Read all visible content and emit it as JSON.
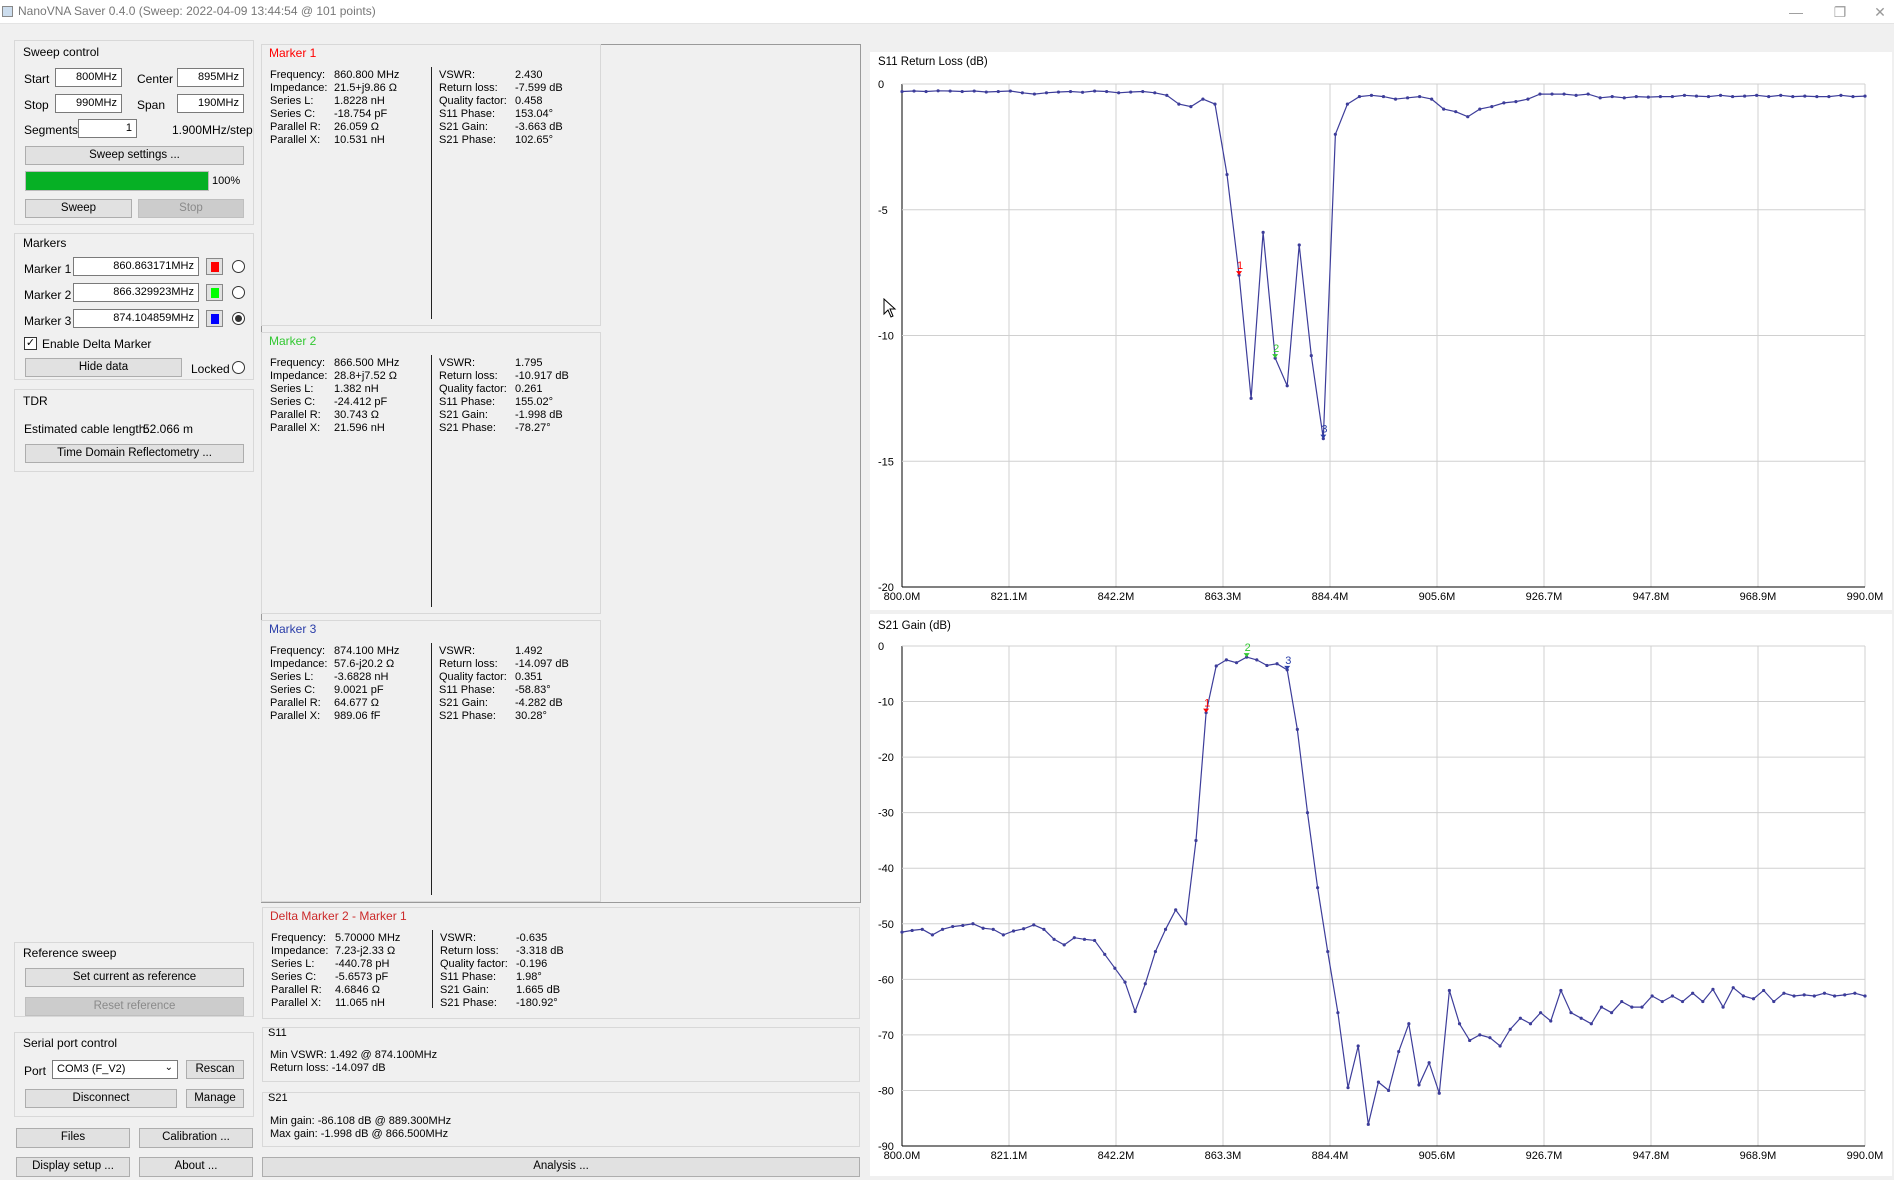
{
  "window": {
    "title": "NanoVNA Saver 0.4.0 (Sweep: 2022-04-09 13:44:54 @ 101 points)",
    "minimize": "—",
    "restore": "❐",
    "close": "✕"
  },
  "sweep_control": {
    "title": "Sweep control",
    "start_label": "Start",
    "start_value": "800MHz",
    "center_label": "Center",
    "center_value": "895MHz",
    "stop_label": "Stop",
    "stop_value": "990MHz",
    "span_label": "Span",
    "span_value": "190MHz",
    "segments_label": "Segments",
    "segments_value": "1",
    "step": "1.900MHz/step",
    "settings_button": "Sweep settings ...",
    "progress_percent": 100,
    "progress_label": "100%",
    "sweep_button": "Sweep",
    "stop_button": "Stop"
  },
  "markers": {
    "title": "Markers",
    "items": [
      {
        "label": "Marker 1",
        "value": "860.863171MHz",
        "color": "#ff0000",
        "selected": false
      },
      {
        "label": "Marker 2",
        "value": "866.329923MHz",
        "color": "#00ff00",
        "selected": false
      },
      {
        "label": "Marker 3",
        "value": "874.104859MHz",
        "color": "#0000ff",
        "selected": true
      }
    ],
    "delta_label": "Enable Delta Marker",
    "delta_checked": "✓",
    "hide_button": "Hide data",
    "locked_label": "Locked"
  },
  "tdr": {
    "title": "TDR",
    "cable_label": "Estimated cable length:",
    "cable_value": "52.066 m",
    "button": "Time Domain Reflectometry ..."
  },
  "reference": {
    "title": "Reference sweep",
    "set_button": "Set current as reference",
    "reset_button": "Reset reference"
  },
  "serial": {
    "title": "Serial port control",
    "port_label": "Port",
    "port_value": "COM3 (F_V2)",
    "rescan_button": "Rescan",
    "disconnect_button": "Disconnect",
    "manage_button": "Manage"
  },
  "bottom_buttons": {
    "files": "Files",
    "calibration": "Calibration ...",
    "display": "Display setup ...",
    "about": "About ...",
    "analysis": "Analysis ..."
  },
  "marker_panels": [
    {
      "title": "Marker 1",
      "color": "#ff0000",
      "left": [
        [
          "Frequency:",
          "860.800 MHz"
        ],
        [
          "Impedance:",
          "21.5+j9.86 Ω"
        ],
        [
          "Series L:",
          "1.8228 nH"
        ],
        [
          "Series C:",
          "-18.754 pF"
        ],
        [
          "Parallel R:",
          "26.059 Ω"
        ],
        [
          "Parallel X:",
          "10.531 nH"
        ]
      ],
      "right": [
        [
          "VSWR:",
          "2.430"
        ],
        [
          "Return loss:",
          "-7.599 dB"
        ],
        [
          "Quality factor:",
          "0.458"
        ],
        [
          "S11 Phase:",
          "153.04°"
        ],
        [
          "S21 Gain:",
          "-3.663 dB"
        ],
        [
          "S21 Phase:",
          "102.65°"
        ]
      ]
    },
    {
      "title": "Marker 2",
      "color": "#32c832",
      "left": [
        [
          "Frequency:",
          "866.500 MHz"
        ],
        [
          "Impedance:",
          "28.8+j7.52 Ω"
        ],
        [
          "Series L:",
          "1.382 nH"
        ],
        [
          "Series C:",
          "-24.412 pF"
        ],
        [
          "Parallel R:",
          "30.743 Ω"
        ],
        [
          "Parallel X:",
          "21.596 nH"
        ]
      ],
      "right": [
        [
          "VSWR:",
          "1.795"
        ],
        [
          "Return loss:",
          "-10.917 dB"
        ],
        [
          "Quality factor:",
          "0.261"
        ],
        [
          "S11 Phase:",
          "155.02°"
        ],
        [
          "S21 Gain:",
          "-1.998 dB"
        ],
        [
          "S21 Phase:",
          "-78.27°"
        ]
      ]
    },
    {
      "title": "Marker 3",
      "color": "#2a3da8",
      "left": [
        [
          "Frequency:",
          "874.100 MHz"
        ],
        [
          "Impedance:",
          "57.6-j20.2 Ω"
        ],
        [
          "Series L:",
          "-3.6828 nH"
        ],
        [
          "Series C:",
          "9.0021 pF"
        ],
        [
          "Parallel R:",
          "64.677 Ω"
        ],
        [
          "Parallel X:",
          "989.06 fF"
        ]
      ],
      "right": [
        [
          "VSWR:",
          "1.492"
        ],
        [
          "Return loss:",
          "-14.097 dB"
        ],
        [
          "Quality factor:",
          "0.351"
        ],
        [
          "S11 Phase:",
          "-58.83°"
        ],
        [
          "S21 Gain:",
          "-4.282 dB"
        ],
        [
          "S21 Phase:",
          "30.28°"
        ]
      ]
    },
    {
      "title": "Delta Marker 2 - Marker 1",
      "color": "#cc2a2a",
      "left": [
        [
          "Frequency:",
          "5.70000 MHz"
        ],
        [
          "Impedance:",
          "7.23-j2.33 Ω"
        ],
        [
          "Series L:",
          "-440.78 pH"
        ],
        [
          "Series C:",
          "-5.6573 pF"
        ],
        [
          "Parallel R:",
          "4.6846 Ω"
        ],
        [
          "Parallel X:",
          "11.065 nH"
        ]
      ],
      "right": [
        [
          "VSWR:",
          "-0.635"
        ],
        [
          "Return loss:",
          "-3.318 dB"
        ],
        [
          "Quality factor:",
          "-0.196"
        ],
        [
          "S11 Phase:",
          "1.98°"
        ],
        [
          "S21 Gain:",
          "1.665 dB"
        ],
        [
          "S21 Phase:",
          "-180.92°"
        ]
      ]
    }
  ],
  "s11_summary": {
    "title": "S11",
    "min_vswr": "Min VSWR:   1.492 @ 874.100MHz",
    "return_loss": "Return loss:  -14.097 dB"
  },
  "s21_summary": {
    "title": "S21",
    "min_gain": "Min gain:  -86.108 dB @ 889.300MHz",
    "max_gain": "Max gain:  -1.998 dB @ 866.500MHz"
  },
  "chart_data": [
    {
      "type": "line",
      "title": "S11 Return Loss (dB)",
      "xlim": [
        800,
        990
      ],
      "ylim": [
        -20,
        0
      ],
      "xticks": [
        "800.0M",
        "821.1M",
        "842.2M",
        "863.3M",
        "884.4M",
        "905.6M",
        "926.7M",
        "947.8M",
        "968.9M",
        "990.0M"
      ],
      "yticks": [
        0,
        -5,
        -10,
        -15,
        -20
      ],
      "grid": true,
      "color": "#3d3d9a",
      "values": [
        -0.3,
        -0.28,
        -0.3,
        -0.27,
        -0.28,
        -0.3,
        -0.28,
        -0.32,
        -0.3,
        -0.28,
        -0.35,
        -0.4,
        -0.35,
        -0.32,
        -0.3,
        -0.33,
        -0.28,
        -0.3,
        -0.35,
        -0.32,
        -0.3,
        -0.35,
        -0.45,
        -0.8,
        -0.9,
        -0.6,
        -0.8,
        -3.6,
        -7.6,
        -12.5,
        -5.9,
        -10.9,
        -12.0,
        -6.4,
        -10.8,
        -14.1,
        -2.0,
        -0.8,
        -0.5,
        -0.45,
        -0.5,
        -0.6,
        -0.55,
        -0.5,
        -0.6,
        -1.0,
        -1.1,
        -1.3,
        -1.0,
        -0.9,
        -0.75,
        -0.7,
        -0.6,
        -0.4,
        -0.4,
        -0.4,
        -0.45,
        -0.4,
        -0.55,
        -0.5,
        -0.55,
        -0.5,
        -0.52,
        -0.5,
        -0.5,
        -0.45,
        -0.48,
        -0.5,
        -0.45,
        -0.5,
        -0.48,
        -0.45,
        -0.5,
        -0.45,
        -0.5,
        -0.48,
        -0.5,
        -0.5,
        -0.45,
        -0.5,
        -0.48
      ],
      "markers": [
        {
          "label": "1",
          "index": 28,
          "color": "#ff0000"
        },
        {
          "label": "2",
          "index": 31,
          "color": "#32c832"
        },
        {
          "label": "3",
          "index": 35,
          "color": "#2a3da8"
        }
      ]
    },
    {
      "type": "line",
      "title": "S21 Gain (dB)",
      "xlim": [
        800,
        990
      ],
      "ylim": [
        -90,
        0
      ],
      "xticks": [
        "800.0M",
        "821.1M",
        "842.2M",
        "863.3M",
        "884.4M",
        "905.6M",
        "926.7M",
        "947.8M",
        "968.9M",
        "990.0M"
      ],
      "yticks": [
        0,
        -10,
        -20,
        -30,
        -40,
        -50,
        -60,
        -70,
        -80,
        -90
      ],
      "grid": true,
      "color": "#3d3d9a",
      "values": [
        -51.5,
        -51.2,
        -51,
        -52,
        -51,
        -50.5,
        -50.3,
        -50,
        -50.8,
        -51,
        -52,
        -51.3,
        -50.9,
        -50.2,
        -51,
        -52.8,
        -53.8,
        -52.5,
        -52.8,
        -53,
        -55.5,
        -58,
        -60.5,
        -65.8,
        -60.8,
        -55,
        -51,
        -47.5,
        -50,
        -35,
        -12,
        -3.6,
        -2.5,
        -3,
        -2,
        -2.5,
        -3.5,
        -3.2,
        -4.3,
        -15,
        -30,
        -43.5,
        -55,
        -66,
        -79.5,
        -72,
        -86.1,
        -78.5,
        -80,
        -73,
        -68,
        -79,
        -75,
        -80.5,
        -62,
        -68,
        -71,
        -70,
        -70.5,
        -72,
        -69,
        -67,
        -68,
        -66,
        -67.5,
        -62,
        -66,
        -67,
        -68,
        -65,
        -66,
        -64,
        -65,
        -65,
        -63,
        -64,
        -63,
        -64,
        -62.5,
        -64,
        -61.8,
        -65,
        -61.5,
        -63,
        -63.5,
        -62,
        -64,
        -62.5,
        -63,
        -62.8,
        -63,
        -62.5,
        -63,
        -62.8,
        -62.5,
        -63
      ],
      "markers": [
        {
          "label": "1",
          "index": 30,
          "color": "#ff0000"
        },
        {
          "label": "2",
          "index": 34,
          "color": "#32c832"
        },
        {
          "label": "3",
          "index": 38,
          "color": "#2a3da8"
        }
      ]
    }
  ]
}
